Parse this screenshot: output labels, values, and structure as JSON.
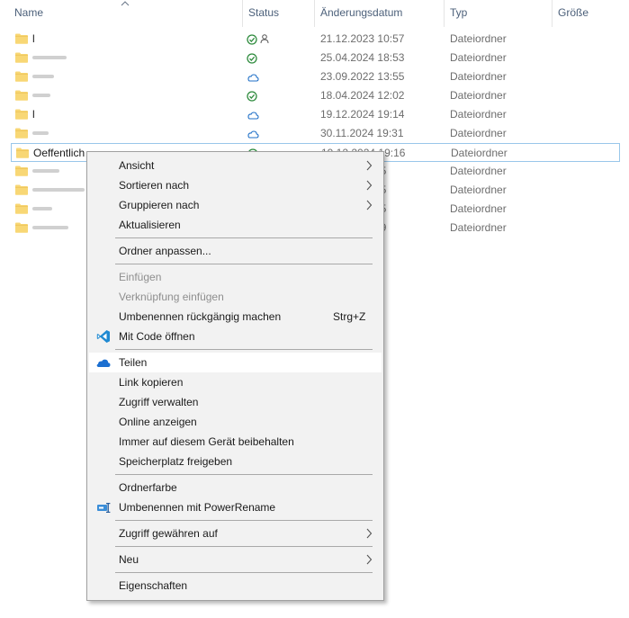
{
  "columns": {
    "name": "Name",
    "status": "Status",
    "date": "Änderungsdatum",
    "type": "Typ",
    "size": "Größe"
  },
  "rows": [
    {
      "name": "l",
      "status": "synced-shared",
      "date": "21.12.2023 10:57",
      "type": "Dateiordner"
    },
    {
      "name": "",
      "status": "synced",
      "date": "25.04.2024 18:53",
      "type": "Dateiordner"
    },
    {
      "name": "",
      "status": "cloud",
      "date": "23.09.2022 13:55",
      "type": "Dateiordner"
    },
    {
      "name": "",
      "status": "synced",
      "date": "18.04.2024 12:02",
      "type": "Dateiordner"
    },
    {
      "name": "l",
      "status": "cloud",
      "date": "19.12.2024 19:14",
      "type": "Dateiordner"
    },
    {
      "name": "",
      "status": "cloud",
      "date": "30.11.2024 19:31",
      "type": "Dateiordner"
    },
    {
      "name": "Oeffentlich",
      "status": "synced",
      "date": "19.12.2024 19:16",
      "type": "Dateiordner",
      "selected": true
    },
    {
      "name": "",
      "status": "",
      "date": "25",
      "type": "Dateiordner"
    },
    {
      "name": "",
      "status": "",
      "date": "55",
      "type": "Dateiordner"
    },
    {
      "name": "",
      "status": "",
      "date": "55",
      "type": "Dateiordner"
    },
    {
      "name": "",
      "status": "",
      "date": "09",
      "type": "Dateiordner"
    }
  ],
  "menu": {
    "items": [
      {
        "label": "Ansicht",
        "submenu": true
      },
      {
        "label": "Sortieren nach",
        "submenu": true
      },
      {
        "label": "Gruppieren nach",
        "submenu": true
      },
      {
        "label": "Aktualisieren"
      },
      {
        "label": "Ordner anpassen..."
      },
      {
        "label": "Einfügen",
        "disabled": true
      },
      {
        "label": "Verknüpfung einfügen",
        "disabled": true
      },
      {
        "label": "Umbenennen rückgängig machen",
        "shortcut": "Strg+Z"
      },
      {
        "label": "Mit Code öffnen",
        "icon": "vscode-icon"
      },
      {
        "label": "Teilen",
        "icon": "onedrive-cloud-icon",
        "hovered": true
      },
      {
        "label": "Link kopieren"
      },
      {
        "label": "Zugriff verwalten"
      },
      {
        "label": "Online anzeigen"
      },
      {
        "label": "Immer auf diesem Gerät beibehalten"
      },
      {
        "label": "Speicherplatz freigeben"
      },
      {
        "label": "Ordnerfarbe"
      },
      {
        "label": "Umbenennen mit PowerRename",
        "icon": "powerrename-icon"
      },
      {
        "label": "Zugriff gewähren auf",
        "submenu": true
      },
      {
        "label": "Neu",
        "submenu": true
      },
      {
        "label": "Eigenschaften"
      }
    ]
  },
  "colors": {
    "header_text": "#4c607a",
    "folder": "#f8d775",
    "synced_green": "#2e8b3d",
    "cloud_blue": "#1f6fc7",
    "menu_bg": "#f2f2f2",
    "selection_border": "#99c7ea"
  }
}
